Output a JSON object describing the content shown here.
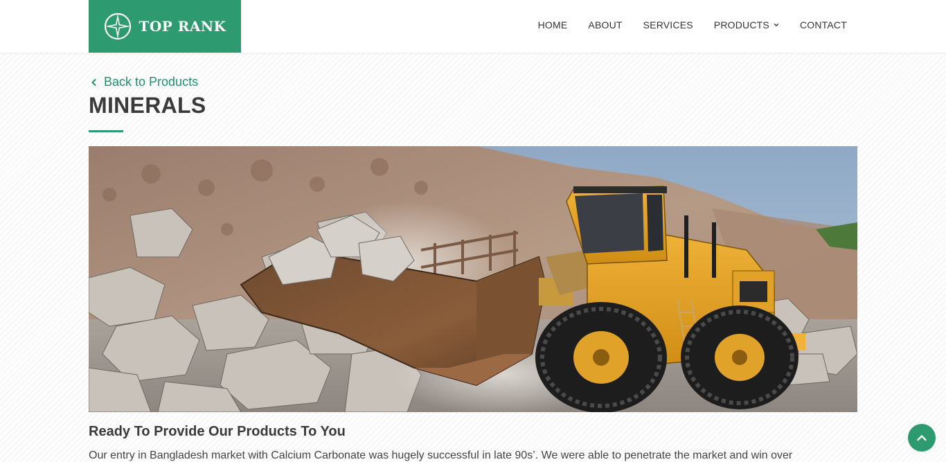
{
  "brand": {
    "name": "TOP RANK",
    "accent_color": "#2e9a6f",
    "logo_icon": "compass-star-icon"
  },
  "nav": {
    "items": [
      {
        "label": "HOME"
      },
      {
        "label": "ABOUT"
      },
      {
        "label": "SERVICES"
      },
      {
        "label": "PRODUCTS",
        "has_dropdown": true
      },
      {
        "label": "CONTACT"
      }
    ]
  },
  "back_link": {
    "label": "Back to Products",
    "icon": "chevron-left-icon"
  },
  "page_title": "MINERALS",
  "hero_image": {
    "alt": "yellow wheel loader in stone quarry"
  },
  "section": {
    "heading": "Ready To Provide Our Products To You",
    "paragraph": "Our entry in Bangladesh market with Calcium Carbonate was hugely successful in late 90s’. We were able to penetrate the market and win over"
  },
  "scroll_top": {
    "icon": "chevron-up-icon"
  }
}
